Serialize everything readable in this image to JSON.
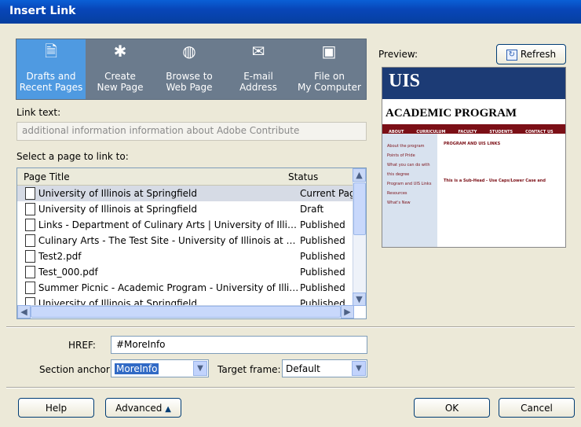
{
  "window": {
    "title": "Insert Link"
  },
  "link_types": [
    {
      "label1": "Drafts and",
      "label2": "Recent Pages",
      "icon": "drafts-icon",
      "selected": true
    },
    {
      "label1": "Create",
      "label2": "New Page",
      "icon": "new-page-icon"
    },
    {
      "label1": "Browse to",
      "label2": "Web Page",
      "icon": "globe-icon"
    },
    {
      "label1": "E-mail",
      "label2": "Address",
      "icon": "email-icon"
    },
    {
      "label1": "File on",
      "label2": "My Computer",
      "icon": "computer-icon"
    }
  ],
  "link_text": {
    "label": "Link text:",
    "value": "additional information information about Adobe Contribute"
  },
  "page_list": {
    "label": "Select a page to link to:",
    "columns": [
      "Page Title",
      "Status"
    ],
    "rows": [
      {
        "title": "University of Illinois at Springfield",
        "status": "Current Page"
      },
      {
        "title": "University of Illinois at Springfield",
        "status": "Draft"
      },
      {
        "title": "Links - Department of Culinary Arts | University of Illinois ...",
        "status": "Published"
      },
      {
        "title": "Culinary Arts - The Test Site - University of Illinois at Spri...",
        "status": "Published"
      },
      {
        "title": "Test2.pdf",
        "status": "Published"
      },
      {
        "title": "Test_000.pdf",
        "status": "Published"
      },
      {
        "title": "Summer Picnic - Academic Program - University of Illinoi...",
        "status": "Published"
      },
      {
        "title": "University of Illinois at Springfield",
        "status": "Published"
      }
    ]
  },
  "preview": {
    "label": "Preview:",
    "refresh_label": "Refresh",
    "site_logo": "UIS",
    "heading": "ACADEMIC PROGRAM",
    "nav": [
      "ABOUT",
      "CURRICULUM",
      "FACULTY",
      "STUDENTS",
      "CONTACT US"
    ],
    "sidebar": [
      "About the program",
      "Points of Pride",
      "What you can do with this degree",
      "Program and UIS Links",
      "Resources",
      "What's New"
    ],
    "content_heading": "PROGRAM AND UIS LINKS",
    "subhead": "This is a Sub-Head - Use Caps/Lower Case and"
  },
  "href": {
    "label": "HREF:",
    "value": "#MoreInfo"
  },
  "section_anchor": {
    "label": "Section anchor:",
    "value": "MoreInfo"
  },
  "target_frame": {
    "label": "Target frame:",
    "value": "Default"
  },
  "buttons": {
    "help": "Help",
    "advanced": "Advanced",
    "ok": "OK",
    "cancel": "Cancel"
  }
}
